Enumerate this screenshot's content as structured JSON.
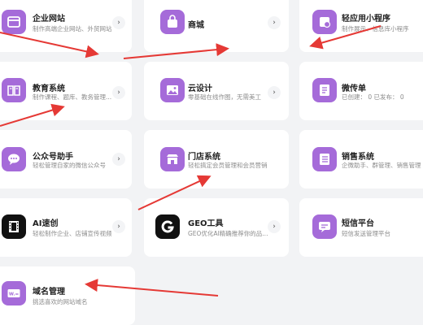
{
  "cards": [
    {
      "title": "企业网站",
      "subtitle": "制作高端企业网站、外贸网站",
      "icon": "browser-icon"
    },
    {
      "title": "商城",
      "subtitle": "",
      "icon": "shopping-bag-icon"
    },
    {
      "title": "轻应用小程序",
      "subtitle": "制作展示、信息库小程序",
      "icon": "mini-program-icon"
    },
    {
      "title": "教育系统",
      "subtitle": "制作课程、题库、教务管理...",
      "icon": "book-icon"
    },
    {
      "title": "云设计",
      "subtitle": "零基础在线作图，无需美工",
      "icon": "image-icon"
    },
    {
      "title": "微传单",
      "subtitle": "已创建： 0    已发布： 0",
      "icon": "document-icon"
    },
    {
      "title": "公众号助手",
      "subtitle": "轻松管理自家的微信公众号",
      "icon": "chat-icon"
    },
    {
      "title": "门店系统",
      "subtitle": "轻松搞定会员管理和会员营销",
      "icon": "store-icon"
    },
    {
      "title": "销售系统",
      "subtitle": "企微助手、群管理、销售管理",
      "icon": "list-icon"
    },
    {
      "title": "AI速创",
      "subtitle": "轻松制作企业、店铺宣传视频",
      "icon": "film-icon"
    },
    {
      "title": "GEO工具",
      "subtitle": "GEO优化AI精确推荐你的品...",
      "icon": "geo-logo-icon"
    },
    {
      "title": "短信平台",
      "subtitle": "短信发送管理平台",
      "icon": "message-icon"
    },
    {
      "title": "域名管理",
      "subtitle": "挑选喜欢的网站域名",
      "icon": "domain-icon"
    }
  ],
  "chevron": "›",
  "colors": {
    "accent": "#a56bd9",
    "annotation": "#e53935",
    "background": "#f2f3f5"
  }
}
